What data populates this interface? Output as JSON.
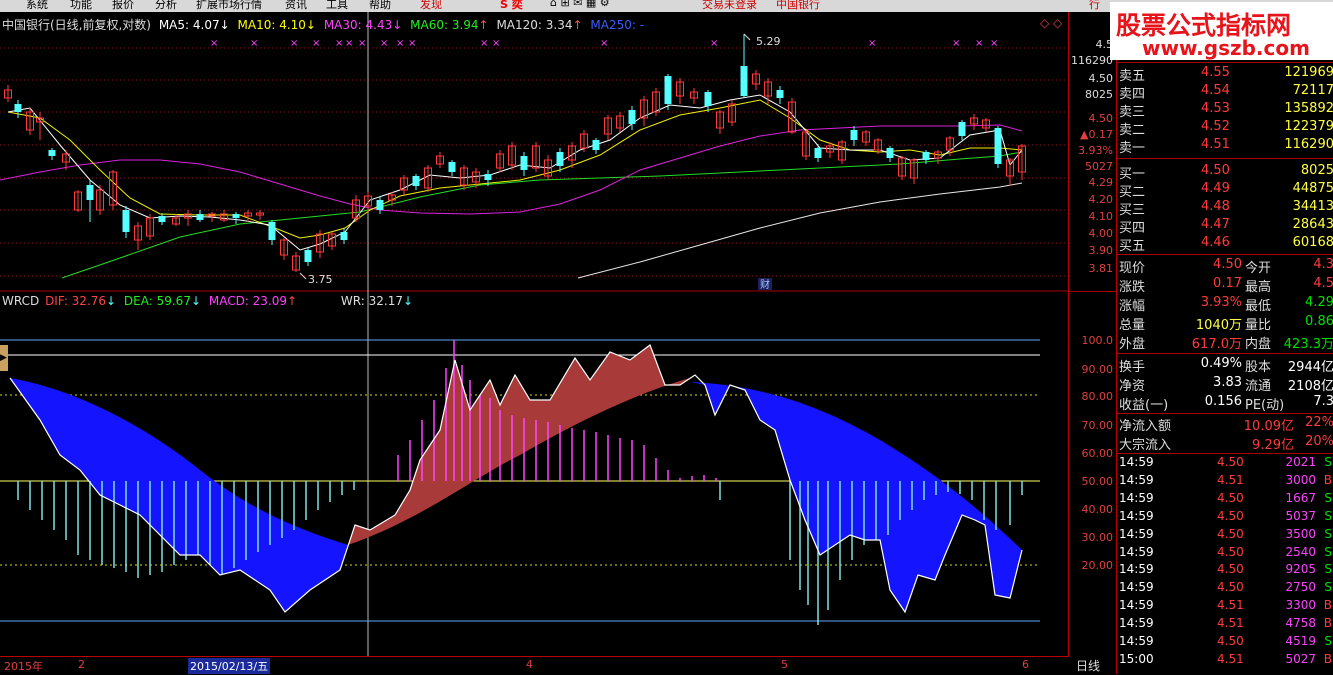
{
  "menu": {
    "items": [
      "系统",
      "功能",
      "报价",
      "分析",
      "扩展市场行情",
      "资讯",
      "工具",
      "帮助"
    ],
    "discover": "发现",
    "trade": "交易未登录",
    "stock_name": "中国银行"
  },
  "price_header": {
    "title": "中国银行(日线,前复权,对数)",
    "ma5": "MA5: 4.07",
    "ma10": "MA10: 4.10",
    "ma30": "MA30: 4.43",
    "ma60": "MA60: 3.94",
    "ma120": "MA120: 3.34",
    "ma250": "MA250: -"
  },
  "price_annotations": {
    "high": "5.29",
    "low": "3.75",
    "fin_marker": "财"
  },
  "indicator_header": {
    "name": "WRCD",
    "dif": "DIF: 32.76",
    "dea": "DEA: 59.67",
    "macd": "MACD: 23.09",
    "wr": "WR: 32.17"
  },
  "right_axis": {
    "price_ticks": [
      "4.5",
      "116290",
      "4.50",
      "8025",
      "4.50",
      "▲0.17",
      "3.93%",
      "5027",
      "4.29",
      "4.20",
      "4.10",
      "4.00",
      "3.90",
      "3.81"
    ],
    "indicator_ticks": [
      "100.0",
      "90.00",
      "80.00",
      "70.00",
      "60.00",
      "50.00",
      "40.00",
      "30.00",
      "20.00"
    ]
  },
  "bottom_axis": {
    "year": "2015年",
    "labels": [
      "2",
      "4",
      "5",
      "6"
    ],
    "cursor_date": "2015/02/13/五",
    "period": "日线"
  },
  "watermark": {
    "title": "股票公式指标网",
    "url": "www.gszb.com"
  },
  "quote": {
    "asks": [
      {
        "label": "卖五",
        "price": "4.55",
        "vol": "121969"
      },
      {
        "label": "卖四",
        "price": "4.54",
        "vol": "72117"
      },
      {
        "label": "卖三",
        "price": "4.53",
        "vol": "135892"
      },
      {
        "label": "卖二",
        "price": "4.52",
        "vol": "122379"
      },
      {
        "label": "卖一",
        "price": "4.51",
        "vol": "116290"
      }
    ],
    "bids": [
      {
        "label": "买一",
        "price": "4.50",
        "vol": "8025"
      },
      {
        "label": "买二",
        "price": "4.49",
        "vol": "44875"
      },
      {
        "label": "买三",
        "price": "4.48",
        "vol": "34413"
      },
      {
        "label": "买四",
        "price": "4.47",
        "vol": "28643"
      },
      {
        "label": "买五",
        "price": "4.46",
        "vol": "60168"
      }
    ],
    "stats": [
      {
        "l1": "现价",
        "v1": "4.50",
        "l2": "今开",
        "v2": "4.3"
      },
      {
        "l1": "涨跌",
        "v1": "0.17",
        "l2": "最高",
        "v2": "4.5"
      },
      {
        "l1": "涨幅",
        "v1": "3.93%",
        "l2": "最低",
        "v2": "4.29"
      },
      {
        "l1": "总量",
        "v1": "1040万",
        "l2": "量比",
        "v2": "0.86"
      },
      {
        "l1": "外盘",
        "v1": "617.0万",
        "l2": "内盘",
        "v2": "423.3万"
      }
    ],
    "stats2": [
      {
        "l1": "换手",
        "v1": "0.49%",
        "l2": "股本",
        "v2": "2944亿"
      },
      {
        "l1": "净资",
        "v1": "3.83",
        "l2": "流通",
        "v2": "2108亿"
      },
      {
        "l1": "收益(一)",
        "v1": "0.156",
        "l2": "PE(动)",
        "v2": "7.3"
      }
    ],
    "flows": [
      {
        "label": "净流入额",
        "v1": "10.09亿",
        "v2": "22%"
      },
      {
        "label": "大宗流入",
        "v1": "9.29亿",
        "v2": "20%"
      }
    ],
    "ticks": [
      {
        "time": "14:59",
        "price": "4.50",
        "vol": "2021",
        "dir": "S"
      },
      {
        "time": "14:59",
        "price": "4.51",
        "vol": "3000",
        "dir": "B"
      },
      {
        "time": "14:59",
        "price": "4.50",
        "vol": "1667",
        "dir": "S"
      },
      {
        "time": "14:59",
        "price": "4.50",
        "vol": "5037",
        "dir": "S"
      },
      {
        "time": "14:59",
        "price": "4.50",
        "vol": "3500",
        "dir": "S"
      },
      {
        "time": "14:59",
        "price": "4.50",
        "vol": "2540",
        "dir": "S"
      },
      {
        "time": "14:59",
        "price": "4.50",
        "vol": "9205",
        "dir": "S"
      },
      {
        "time": "14:59",
        "price": "4.50",
        "vol": "2750",
        "dir": "S"
      },
      {
        "time": "14:59",
        "price": "4.51",
        "vol": "3300",
        "dir": "B"
      },
      {
        "time": "14:59",
        "price": "4.51",
        "vol": "4758",
        "dir": "B"
      },
      {
        "time": "14:59",
        "price": "4.50",
        "vol": "4519",
        "dir": "S"
      },
      {
        "time": "15:00",
        "price": "4.51",
        "vol": "5027",
        "dir": "B"
      }
    ]
  },
  "colors": {
    "up": "#ff3b3b",
    "down": "#54ffff",
    "ma5": "#ffffff",
    "ma10": "#ffff00",
    "ma30": "#ff00ff",
    "ma60": "#00ff00",
    "ma120": "#ffffff",
    "blue_fill": "#1414ff",
    "red_fill": "#a83a3a"
  }
}
